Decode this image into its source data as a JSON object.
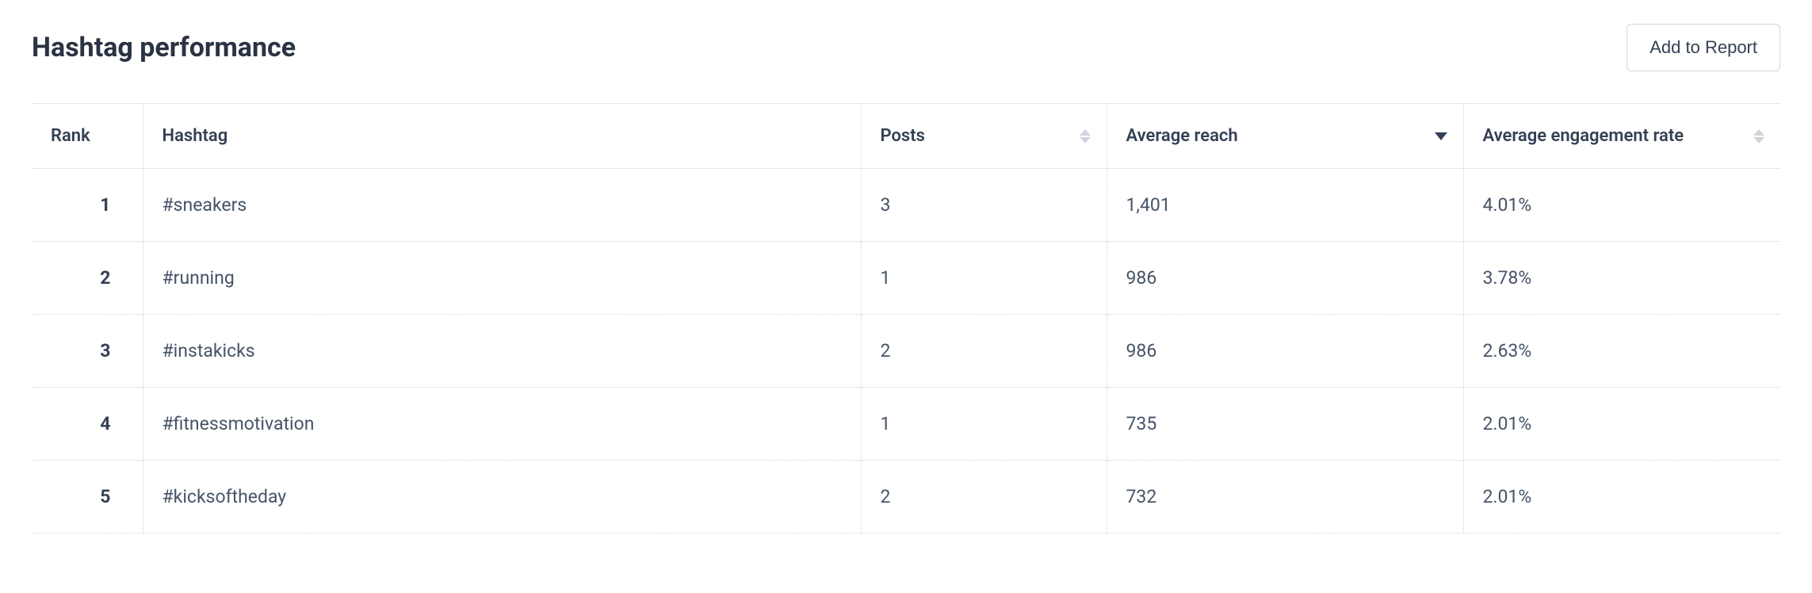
{
  "header": {
    "title": "Hashtag performance",
    "add_report_label": "Add to Report"
  },
  "table": {
    "columns": {
      "rank": "Rank",
      "hashtag": "Hashtag",
      "posts": "Posts",
      "reach": "Average reach",
      "engagement": "Average engagement rate"
    },
    "rows": [
      {
        "rank": "1",
        "hashtag": "#sneakers",
        "posts": "3",
        "reach": "1,401",
        "engagement": "4.01%"
      },
      {
        "rank": "2",
        "hashtag": "#running",
        "posts": "1",
        "reach": "986",
        "engagement": "3.78%"
      },
      {
        "rank": "3",
        "hashtag": "#instakicks",
        "posts": "2",
        "reach": "986",
        "engagement": "2.63%"
      },
      {
        "rank": "4",
        "hashtag": "#fitnessmotivation",
        "posts": "1",
        "reach": "735",
        "engagement": "2.01%"
      },
      {
        "rank": "5",
        "hashtag": "#kicksoftheday",
        "posts": "2",
        "reach": "732",
        "engagement": "2.01%"
      }
    ]
  }
}
